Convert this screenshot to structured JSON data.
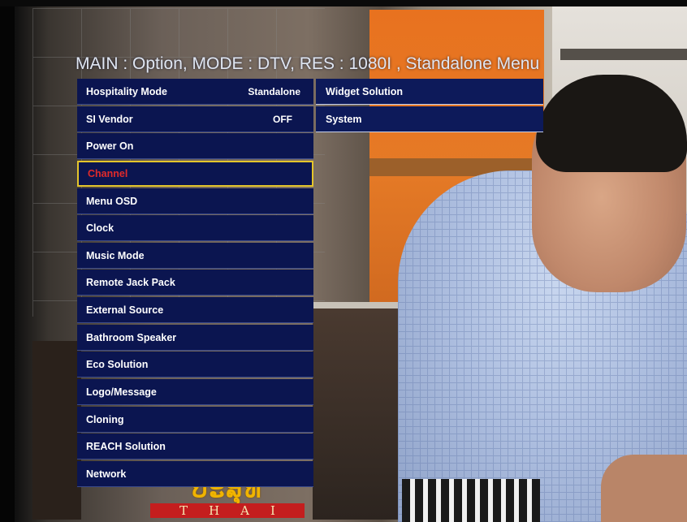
{
  "osd": {
    "title": "MAIN : Option, MODE : DTV, RES : 1080I , Standalone Menu",
    "menu_items": [
      {
        "label": "Hospitality Mode",
        "value": "Standalone"
      },
      {
        "label": "SI Vendor",
        "value": "OFF"
      },
      {
        "label": "Power On",
        "value": ""
      },
      {
        "label": "Channel",
        "value": "",
        "selected": true
      },
      {
        "label": "Menu OSD",
        "value": ""
      },
      {
        "label": "Clock",
        "value": ""
      },
      {
        "label": "Music Mode",
        "value": ""
      },
      {
        "label": "Remote Jack Pack",
        "value": ""
      },
      {
        "label": "External Source",
        "value": ""
      },
      {
        "label": "Bathroom Speaker",
        "value": ""
      },
      {
        "label": "Eco Solution",
        "value": ""
      },
      {
        "label": "Logo/Message",
        "value": ""
      },
      {
        "label": "Cloning",
        "value": ""
      },
      {
        "label": "REACH Solution",
        "value": ""
      },
      {
        "label": "Network",
        "value": ""
      }
    ],
    "submenu_items": [
      {
        "label": "Widget Solution"
      },
      {
        "label": "System"
      }
    ],
    "colors": {
      "menu_bg": "#0b1550",
      "selected_border": "#e4c52b",
      "selected_text": "#e12a2a"
    }
  },
  "channel_logo": {
    "top_text": "ປະສຸທ",
    "bottom_text": "THAI"
  }
}
